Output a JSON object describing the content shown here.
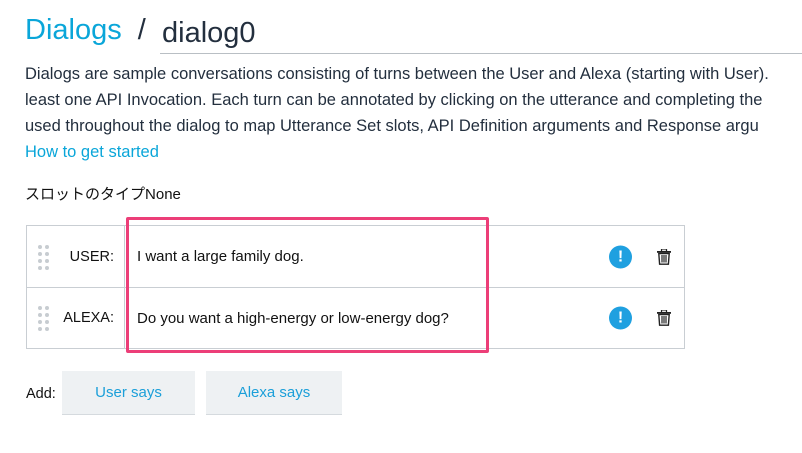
{
  "header": {
    "breadcrumb_link": "Dialogs",
    "separator": "/",
    "dialog_name": "dialog0"
  },
  "description": {
    "lines": [
      "Dialogs are sample conversations consisting of turns between the User and Alexa (starting with User).",
      "least one API Invocation. Each turn can be annotated by clicking on the utterance and completing the",
      "used throughout the dialog to map Utterance Set slots, API Definition arguments and Response argu"
    ],
    "help_link": "How to get started"
  },
  "slot_type": {
    "label": "スロットのタイプ",
    "value": "None"
  },
  "turns": [
    {
      "speaker": "USER:",
      "utterance": "I want a large family dog.",
      "alert_icon": "exclamation-circle-icon",
      "delete_icon": "trash-icon"
    },
    {
      "speaker": "ALEXA:",
      "utterance": "Do you want a high-energy or low-energy dog?",
      "alert_icon": "exclamation-circle-icon",
      "delete_icon": "trash-icon"
    }
  ],
  "add": {
    "label": "Add:",
    "user_button": "User says",
    "alexa_button": "Alexa says"
  },
  "colors": {
    "link": "#0aa6d9",
    "highlight": "#ec3e78",
    "alert": "#1fa0e0",
    "button_bg": "#eef1f3"
  }
}
